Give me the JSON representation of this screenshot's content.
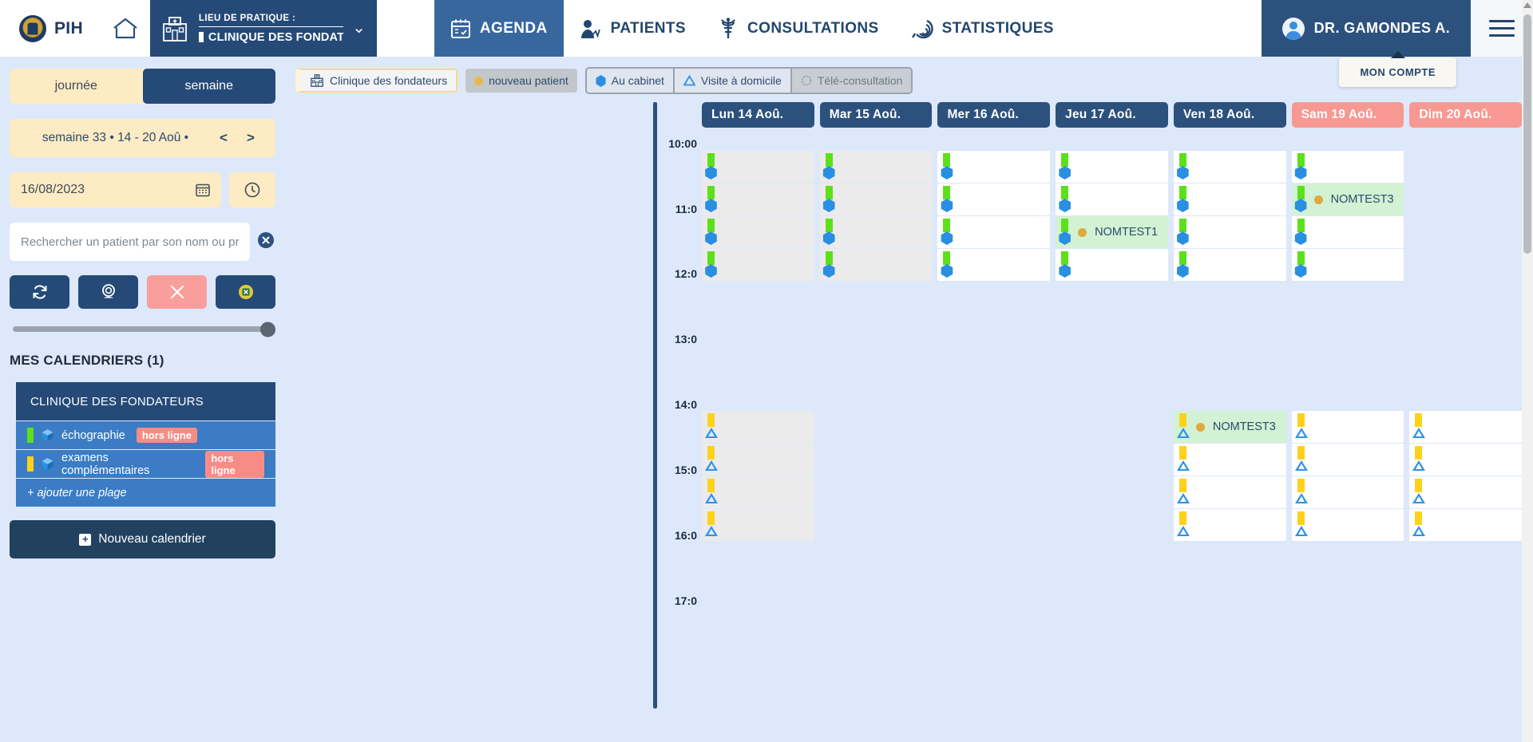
{
  "topnav": {
    "brand": "PIH",
    "home_icon": "home-icon",
    "practice": {
      "label": "LIEU DE PRATIQUE :",
      "value": "CLINIQUE DES FONDATEURS",
      "caret": "chevron-down-icon"
    },
    "tabs": [
      {
        "label": "AGENDA",
        "icon": "calendar-icon",
        "active": true
      },
      {
        "label": "PATIENTS",
        "icon": "patient-icon",
        "active": false
      },
      {
        "label": "CONSULTATIONS",
        "icon": "caduceus-icon",
        "active": false
      },
      {
        "label": "STATISTIQUES",
        "icon": "statistics-icon",
        "active": false
      }
    ],
    "account": {
      "name": "DR. GAMONDES A.",
      "tooltip": "MON COMPTE"
    },
    "menu_icon": "hamburger-menu-icon"
  },
  "sidebar": {
    "view_toggle": {
      "day": "journée",
      "week": "semaine",
      "selected": "semaine"
    },
    "week_nav": {
      "text": "semaine 33 • 14 - 20 Aoû •",
      "prev": "<",
      "next": ">"
    },
    "date_field": {
      "value": "16/08/2023",
      "icon": "calendar-picker-icon"
    },
    "clock_button_icon": "clock-icon",
    "search": {
      "placeholder": "Rechercher un patient par son nom ou prénom",
      "value": "",
      "clear_icon": "clear-circle-icon"
    },
    "actions": [
      {
        "name": "refresh-button",
        "icon": "refresh-icon",
        "style": "dark"
      },
      {
        "name": "webcam-button",
        "icon": "webcam-icon",
        "style": "dark"
      },
      {
        "name": "cancel-button",
        "icon": "close-x-icon",
        "style": "danger"
      },
      {
        "name": "export-excel-button",
        "icon": "excel-icon",
        "style": "dark"
      }
    ],
    "calendars_title": "MES CALENDRIERS (1)",
    "calendar_group": {
      "header": "CLINIQUE DES FONDATEURS",
      "rows": [
        {
          "label": "échographie",
          "badge": "hors ligne",
          "color": "#5ce019"
        },
        {
          "label": "examens complémentaires",
          "badge": "hors ligne",
          "color": "#ffd11a"
        }
      ],
      "add_range": "+ ajouter une plage"
    },
    "new_calendar": "Nouveau calendrier"
  },
  "filters": [
    {
      "label": "Clinique des fondateurs",
      "type": "place",
      "icon": "clinic-icon"
    },
    {
      "label": "nouveau patient",
      "type": "newpatient",
      "icon": "orange-dot-icon"
    },
    {
      "label": "Au cabinet",
      "type": "cabinet",
      "icon": "hexagon-icon"
    },
    {
      "label": "Visite à domicile",
      "type": "domicile",
      "icon": "triangle-icon"
    },
    {
      "label": "Télé-consultation",
      "type": "tele",
      "icon": "tele-icon"
    }
  ],
  "calendar": {
    "days": [
      {
        "label": "Lun 14 Aoû.",
        "weekend": false
      },
      {
        "label": "Mar 15 Aoû.",
        "weekend": false
      },
      {
        "label": "Mer 16 Aoû.",
        "weekend": false
      },
      {
        "label": "Jeu 17 Aoû.",
        "weekend": false
      },
      {
        "label": "Ven 18 Aoû.",
        "weekend": false
      },
      {
        "label": "Sam 19 Aoû.",
        "weekend": true
      },
      {
        "label": "Dim 20 Aoû.",
        "weekend": true
      }
    ],
    "time_labels": [
      "10:00",
      "11:0",
      "12:0",
      "13:0",
      "14:0",
      "15:0",
      "16:0",
      "17:0"
    ],
    "morning_slots": [
      {
        "row": 0,
        "days": [
          {
            "day": 0,
            "state": "past"
          },
          {
            "day": 1,
            "state": "past"
          },
          {
            "day": 2,
            "state": "free"
          },
          {
            "day": 3,
            "state": "free"
          },
          {
            "day": 4,
            "state": "free"
          },
          {
            "day": 5,
            "state": "free"
          }
        ]
      },
      {
        "row": 1,
        "days": [
          {
            "day": 0,
            "state": "past"
          },
          {
            "day": 1,
            "state": "past"
          },
          {
            "day": 2,
            "state": "free"
          },
          {
            "day": 3,
            "state": "free"
          },
          {
            "day": 4,
            "state": "free"
          },
          {
            "day": 5,
            "state": "booked",
            "patient": "NOMTEST3"
          }
        ]
      },
      {
        "row": 2,
        "days": [
          {
            "day": 0,
            "state": "past"
          },
          {
            "day": 1,
            "state": "past"
          },
          {
            "day": 2,
            "state": "free"
          },
          {
            "day": 3,
            "state": "booked",
            "patient": "NOMTEST1"
          },
          {
            "day": 4,
            "state": "free"
          },
          {
            "day": 5,
            "state": "free"
          }
        ]
      },
      {
        "row": 3,
        "days": [
          {
            "day": 0,
            "state": "past"
          },
          {
            "day": 1,
            "state": "past"
          },
          {
            "day": 2,
            "state": "free"
          },
          {
            "day": 3,
            "state": "free"
          },
          {
            "day": 4,
            "state": "free"
          },
          {
            "day": 5,
            "state": "free"
          }
        ]
      }
    ],
    "afternoon_slots": [
      {
        "row": 0,
        "days": [
          {
            "day": 0,
            "state": "past"
          },
          {
            "day": 4,
            "state": "booked",
            "patient": "NOMTEST3"
          },
          {
            "day": 5,
            "state": "free"
          },
          {
            "day": 6,
            "state": "free"
          }
        ]
      },
      {
        "row": 1,
        "days": [
          {
            "day": 0,
            "state": "past"
          },
          {
            "day": 4,
            "state": "free"
          },
          {
            "day": 5,
            "state": "free"
          },
          {
            "day": 6,
            "state": "free"
          }
        ]
      },
      {
        "row": 2,
        "days": [
          {
            "day": 0,
            "state": "past"
          },
          {
            "day": 4,
            "state": "free"
          },
          {
            "day": 5,
            "state": "free"
          },
          {
            "day": 6,
            "state": "free"
          }
        ]
      },
      {
        "row": 3,
        "days": [
          {
            "day": 0,
            "state": "past"
          },
          {
            "day": 4,
            "state": "free"
          },
          {
            "day": 5,
            "state": "free"
          },
          {
            "day": 6,
            "state": "free"
          }
        ]
      }
    ]
  }
}
